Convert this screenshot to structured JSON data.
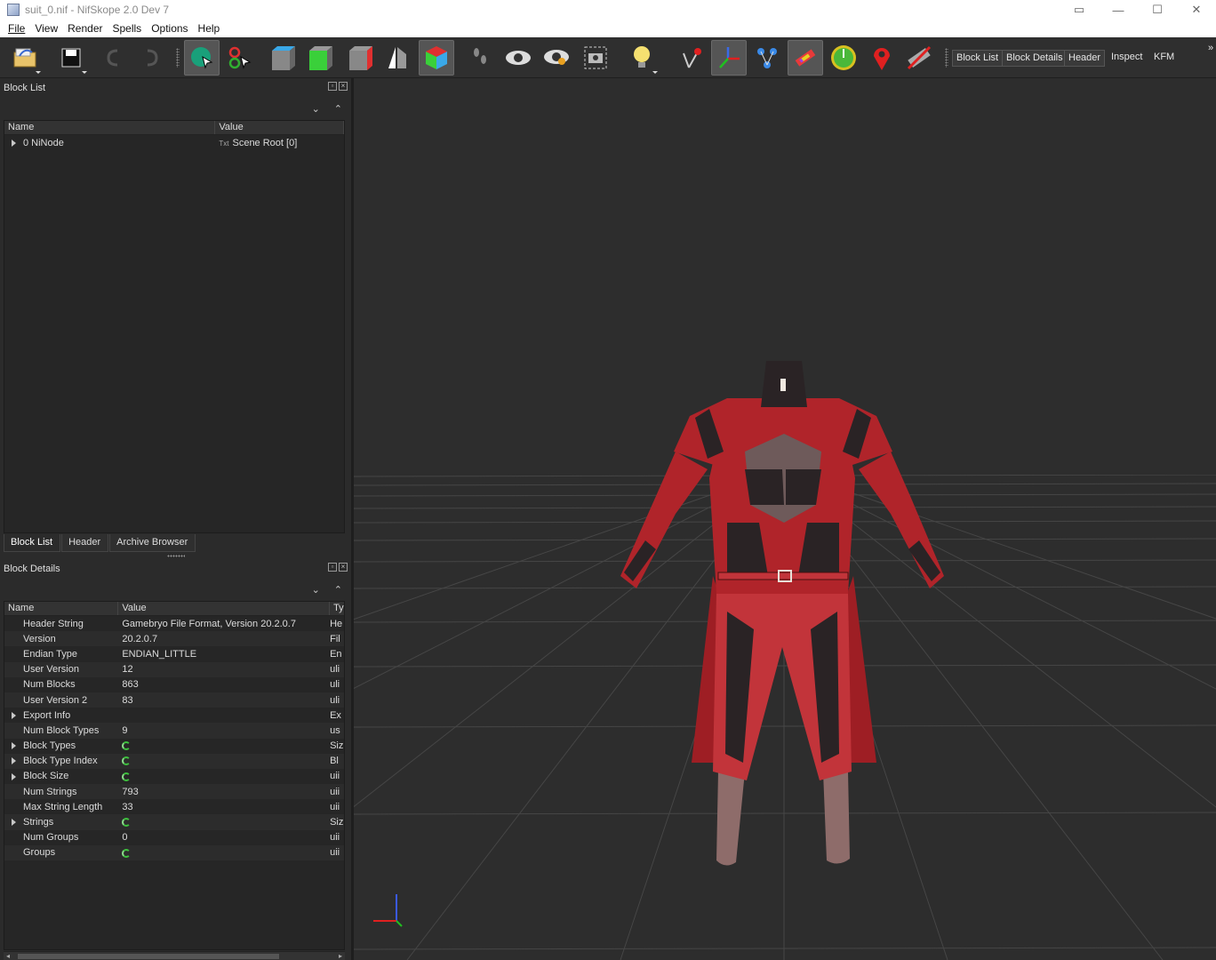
{
  "window": {
    "title": "suit_0.nif - NifSkope 2.0 Dev 7"
  },
  "menu": [
    "File",
    "View",
    "Render",
    "Spells",
    "Options",
    "Help"
  ],
  "toolbar": {
    "icons": [
      "open-icon",
      "save-icon",
      "undo-icon",
      "redo-icon",
      "select-icon",
      "select-object-icon",
      "view-top-icon",
      "view-front-icon",
      "view-side-icon",
      "view-flip-icon",
      "view-perspective-icon",
      "walk-icon",
      "visibility-icon",
      "hide-icon",
      "screenshot-icon",
      "light-icon",
      "axes-pin-icon",
      "axes-icon",
      "nodes-icon",
      "skeleton-icon",
      "compass-icon",
      "marker-icon",
      "disable-icon"
    ],
    "text_buttons": [
      "Block List",
      "Block Details",
      "Header",
      "Inspect",
      "KFM"
    ]
  },
  "block_list": {
    "title": "Block List",
    "columns": [
      "Name",
      "Value"
    ],
    "rows": [
      {
        "name": "0 NiNode",
        "value": "Scene Root [0]"
      }
    ]
  },
  "tabs": [
    "Block List",
    "Header",
    "Archive Browser"
  ],
  "block_details": {
    "title": "Block Details",
    "columns": [
      "Name",
      "Value",
      "Ty"
    ],
    "rows": [
      {
        "name": "Header String",
        "value": "Gamebryo File Format, Version 20.2.0.7",
        "type": "He",
        "expand": false,
        "icon": false
      },
      {
        "name": "Version",
        "value": "20.2.0.7",
        "type": "Fil",
        "expand": false,
        "icon": false
      },
      {
        "name": "Endian Type",
        "value": "ENDIAN_LITTLE",
        "type": "En",
        "expand": false,
        "icon": false
      },
      {
        "name": "User Version",
        "value": "12",
        "type": "uli",
        "expand": false,
        "icon": false
      },
      {
        "name": "Num Blocks",
        "value": "863",
        "type": "uli",
        "expand": false,
        "icon": false
      },
      {
        "name": "User Version 2",
        "value": "83",
        "type": "uli",
        "expand": false,
        "icon": false
      },
      {
        "name": "Export Info",
        "value": "",
        "type": "Ex",
        "expand": true,
        "icon": false
      },
      {
        "name": "Num Block Types",
        "value": "9",
        "type": "us",
        "expand": false,
        "icon": false
      },
      {
        "name": "Block Types",
        "value": "",
        "type": "Siz",
        "expand": true,
        "icon": true
      },
      {
        "name": "Block Type Index",
        "value": "",
        "type": "Bl",
        "expand": true,
        "icon": true
      },
      {
        "name": "Block Size",
        "value": "",
        "type": "uii",
        "expand": true,
        "icon": true
      },
      {
        "name": "Num Strings",
        "value": "793",
        "type": "uii",
        "expand": false,
        "icon": false
      },
      {
        "name": "Max String Length",
        "value": "33",
        "type": "uii",
        "expand": false,
        "icon": false
      },
      {
        "name": "Strings",
        "value": "",
        "type": "Siz",
        "expand": true,
        "icon": true
      },
      {
        "name": "Num Groups",
        "value": "0",
        "type": "uii",
        "expand": false,
        "icon": false
      },
      {
        "name": "Groups",
        "value": "",
        "type": "uii",
        "expand": false,
        "icon": true
      }
    ]
  },
  "colors": {
    "suit_red": "#b0242a",
    "suit_dark": "#2a2325",
    "skin": "#8e6c6a",
    "viewport_bg": "#2d2d2d",
    "grid": "#4a4a4a"
  }
}
